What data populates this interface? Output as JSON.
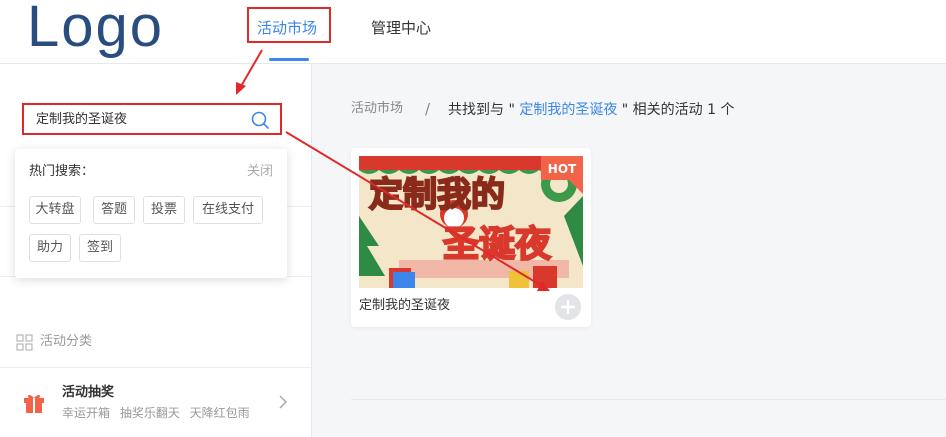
{
  "header": {
    "logo": "Logo",
    "nav": [
      {
        "label": "活动市场",
        "active": true
      },
      {
        "label": "管理中心",
        "active": false
      }
    ]
  },
  "search": {
    "value": "定制我的圣诞夜",
    "hot_title": "热门搜索：",
    "close_label": "关闭",
    "hot_tags": [
      "大转盘",
      "答题",
      "投票",
      "在线支付",
      "助力",
      "签到"
    ]
  },
  "sidebar": {
    "category_header": "活动分类",
    "items": [
      {
        "title": "活动抽奖",
        "subtitle": "幸运开箱 抽奖乐翻天 天降红包雨"
      }
    ]
  },
  "breadcrumb": {
    "root": "活动市场",
    "separator": "/",
    "prefix": "共找到与 \" ",
    "keyword": "定制我的圣诞夜",
    "suffix": " \" 相关的活动 1 个"
  },
  "results": [
    {
      "name": "定制我的圣诞夜",
      "badge": "HOT",
      "cover_text_1": "定制我的",
      "cover_text_2": "圣诞夜"
    }
  ],
  "colors": {
    "accent": "#3b86e8",
    "annotation": "#e02a2a",
    "hot": "#f2644a"
  },
  "icons": [
    "search-icon",
    "grid-icon",
    "gift-icon",
    "chevron-right-icon",
    "plus-circle-icon"
  ]
}
